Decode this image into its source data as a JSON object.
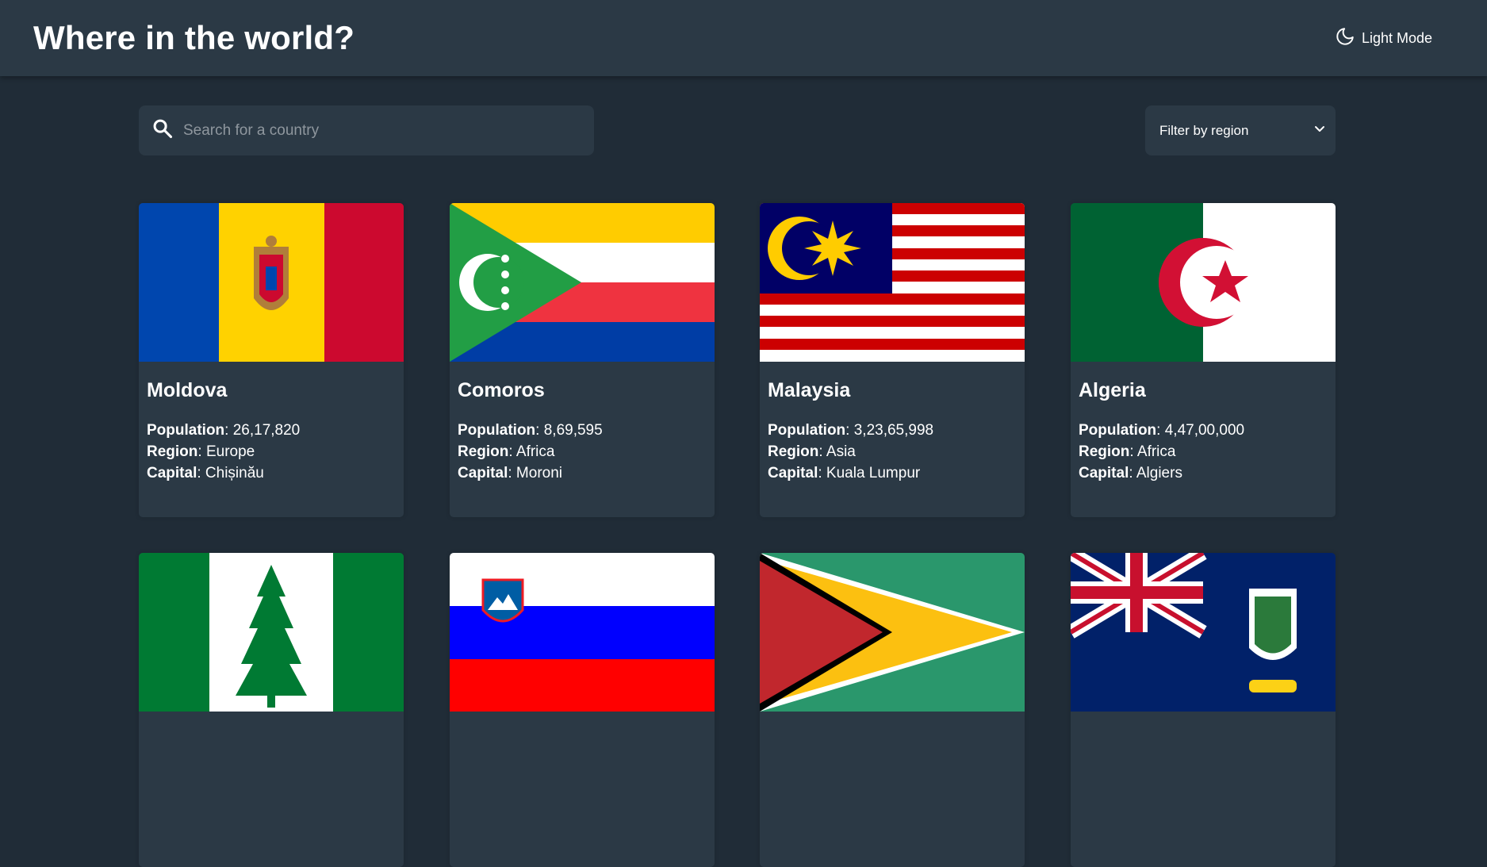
{
  "header": {
    "title": "Where in the world?",
    "mode_label": "Light Mode",
    "mode_icon": "moon-icon"
  },
  "search": {
    "placeholder": "Search for a country",
    "icon": "search-icon"
  },
  "filter": {
    "label": "Filter by region",
    "icon": "chevron-down-icon"
  },
  "labels": {
    "population": "Population",
    "region": "Region",
    "capital": "Capital"
  },
  "countries": [
    {
      "name": "Moldova",
      "population": "26,17,820",
      "region": "Europe",
      "capital": "Chișinău",
      "flag": "moldova-flag"
    },
    {
      "name": "Comoros",
      "population": "8,69,595",
      "region": "Africa",
      "capital": "Moroni",
      "flag": "comoros-flag"
    },
    {
      "name": "Malaysia",
      "population": "3,23,65,998",
      "region": "Asia",
      "capital": "Kuala Lumpur",
      "flag": "malaysia-flag"
    },
    {
      "name": "Algeria",
      "population": "4,47,00,000",
      "region": "Africa",
      "capital": "Algiers",
      "flag": "algeria-flag"
    },
    {
      "flag": "norfolk-island-flag"
    },
    {
      "flag": "slovenia-flag"
    },
    {
      "flag": "guyana-flag"
    },
    {
      "flag": "south-georgia-flag"
    }
  ],
  "colors": {
    "background": "#202c37",
    "element": "#2b3945",
    "text": "#ffffff",
    "placeholder": "#8f979e"
  }
}
